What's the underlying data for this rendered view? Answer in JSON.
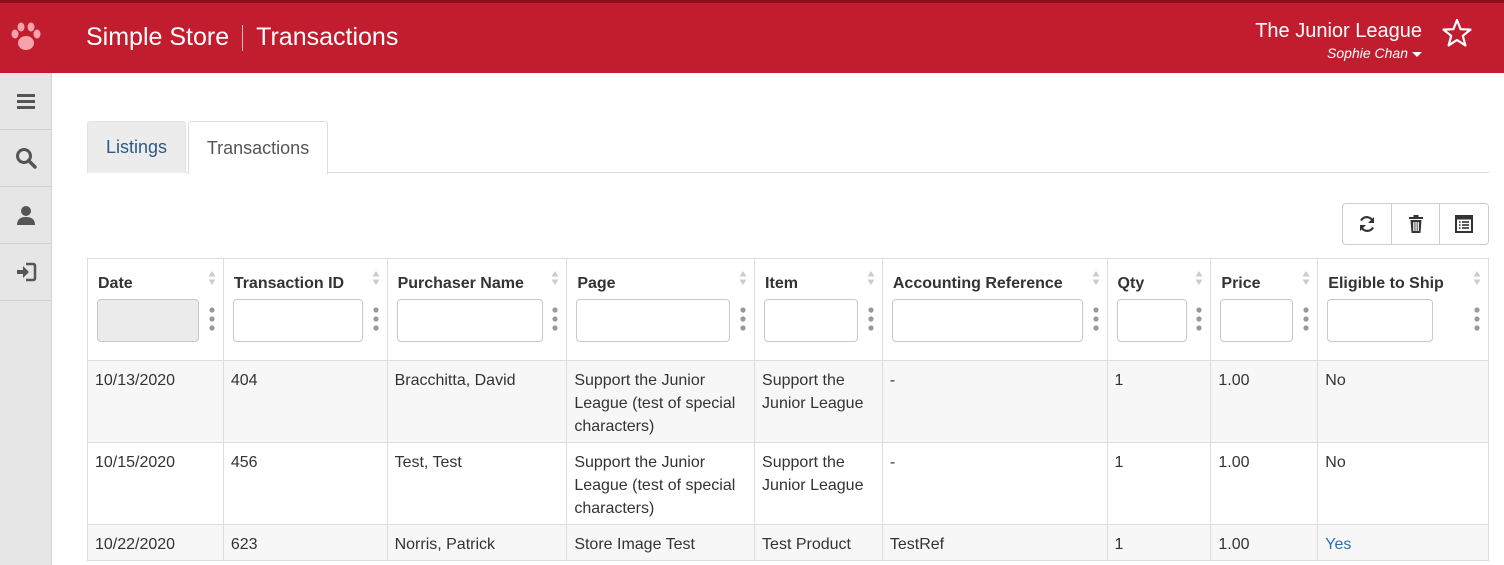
{
  "header": {
    "app_name": "Simple Store",
    "page_name": "Transactions",
    "org_name": "The Junior League",
    "user_name": "Sophie Chan",
    "bg_color": "#c21d2e"
  },
  "sidebar": {
    "items": [
      {
        "icon": "menu-icon"
      },
      {
        "icon": "search-icon"
      },
      {
        "icon": "user-icon"
      },
      {
        "icon": "sign-in-icon"
      }
    ]
  },
  "tabs": [
    {
      "label": "Listings",
      "active": false
    },
    {
      "label": "Transactions",
      "active": true
    }
  ],
  "toolbar": {
    "buttons": [
      {
        "icon": "refresh-icon"
      },
      {
        "icon": "trash-icon"
      },
      {
        "icon": "column-chooser-icon"
      }
    ]
  },
  "table": {
    "columns": [
      "Date",
      "Transaction ID",
      "Purchaser Name",
      "Page",
      "Item",
      "Accounting Reference",
      "Qty",
      "Price",
      "Eligible to Ship"
    ],
    "rows": [
      [
        "10/13/2020",
        "404",
        "Bracchitta, David",
        "Support the Junior League (test of special characters)",
        "Support the Junior League",
        "-",
        "1",
        "1.00",
        "No"
      ],
      [
        "10/15/2020",
        "456",
        "Test, Test",
        "Support the Junior League (test of special characters)",
        "Support the Junior League",
        "-",
        "1",
        "1.00",
        "No"
      ],
      [
        "10/22/2020",
        "623",
        "Norris, Patrick",
        "Store Image Test",
        "Test Product",
        "TestRef",
        "1",
        "1.00",
        "Yes"
      ]
    ],
    "link_color": "#2c6fae"
  }
}
